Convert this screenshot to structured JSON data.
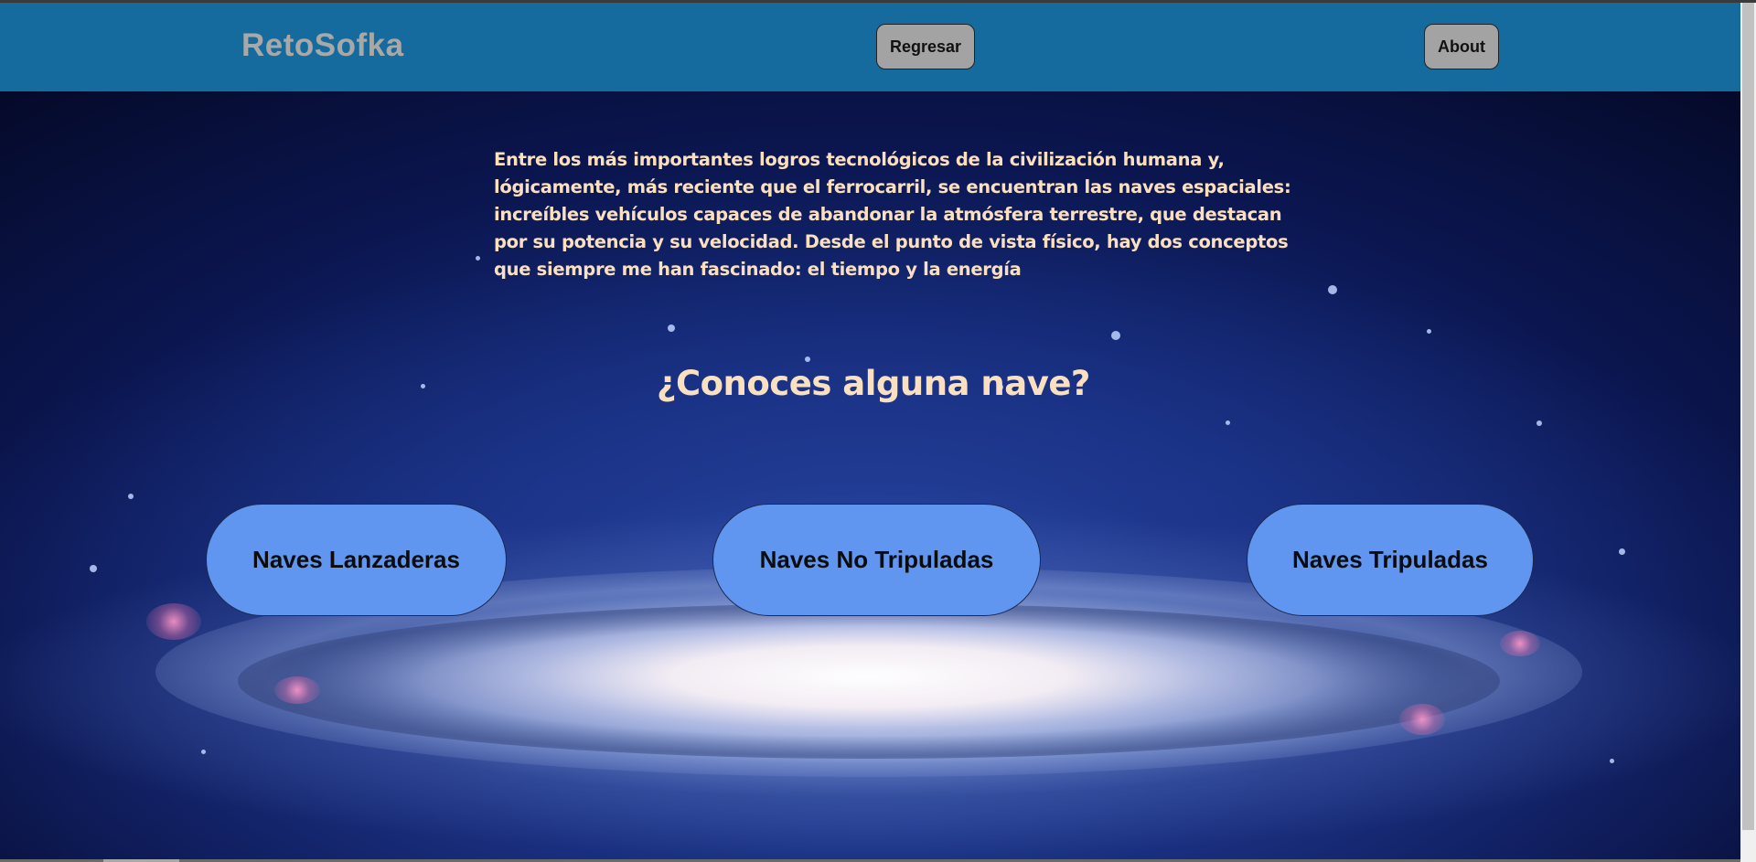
{
  "navbar": {
    "brand": "RetoSofka",
    "regresar_label": "Regresar",
    "about_label": "About"
  },
  "main": {
    "intro": "Entre los más importantes logros tecnológicos de la civilización humana y, lógicamente, más reciente que el ferrocarril, se encuentran las naves espaciales: increíbles vehículos capaces de abandonar la atmósfera terrestre, que destacan por su potencia y su velocidad. Desde el punto de vista físico, hay dos conceptos que siempre me han fascinado: el tiempo y la energía",
    "question": "¿Conoces alguna nave?",
    "categories": [
      {
        "label": "Naves Lanzaderas"
      },
      {
        "label": "Naves No Tripuladas"
      },
      {
        "label": "Naves Tripuladas"
      }
    ]
  },
  "colors": {
    "navbar_bg": "#166b9e",
    "brand_text": "#a8a8a8",
    "nav_button_bg": "#a3a3a3",
    "text_accent": "#fbe0c0",
    "category_button_bg": "#6095f0"
  }
}
